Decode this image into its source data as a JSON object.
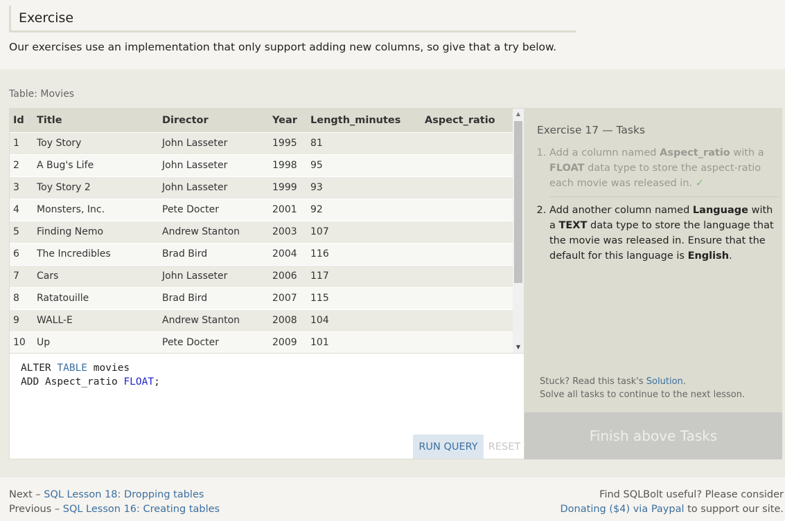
{
  "section": {
    "title": "Exercise",
    "intro": "Our exercises use an implementation that only support adding new columns, so give that a try below."
  },
  "table": {
    "caption": "Table: Movies",
    "columns": [
      "Id",
      "Title",
      "Director",
      "Year",
      "Length_minutes",
      "Aspect_ratio"
    ],
    "rows": [
      [
        "1",
        "Toy Story",
        "John Lasseter",
        "1995",
        "81",
        ""
      ],
      [
        "2",
        "A Bug's Life",
        "John Lasseter",
        "1998",
        "95",
        ""
      ],
      [
        "3",
        "Toy Story 2",
        "John Lasseter",
        "1999",
        "93",
        ""
      ],
      [
        "4",
        "Monsters, Inc.",
        "Pete Docter",
        "2001",
        "92",
        ""
      ],
      [
        "5",
        "Finding Nemo",
        "Andrew Stanton",
        "2003",
        "107",
        ""
      ],
      [
        "6",
        "The Incredibles",
        "Brad Bird",
        "2004",
        "116",
        ""
      ],
      [
        "7",
        "Cars",
        "John Lasseter",
        "2006",
        "117",
        ""
      ],
      [
        "8",
        "Ratatouille",
        "Brad Bird",
        "2007",
        "115",
        ""
      ],
      [
        "9",
        "WALL-E",
        "Andrew Stanton",
        "2008",
        "104",
        ""
      ],
      [
        "10",
        "Up",
        "Pete Docter",
        "2009",
        "101",
        ""
      ]
    ]
  },
  "editor": {
    "line1_kw1": "ALTER",
    "line1_kw2": "TABLE",
    "line1_ident": "movies",
    "line2_kw": "ADD",
    "line2_ident": "Aspect_ratio",
    "line2_type": "FLOAT",
    "line2_end": ";",
    "run_label": "RUN QUERY",
    "reset_label": "RESET"
  },
  "tasks": {
    "title": "Exercise 17 — Tasks",
    "task1": {
      "t1": "Add a column named ",
      "b1": "Aspect_ratio",
      "t2": " with a ",
      "b2": "FLOAT",
      "t3": " data type to store the aspect-ratio each movie was released in. ",
      "check": "✓"
    },
    "task2": {
      "t1": "Add another column named ",
      "b1": "Language",
      "t2": " with a ",
      "b2": "TEXT",
      "t3": " data type to store the language that the movie was released in. Ensure that the default for this language is ",
      "b3": "English",
      "t4": "."
    },
    "stuck_prefix": "Stuck? Read this task's ",
    "solution_link": "Solution",
    "stuck_suffix": ".",
    "solve_note": "Solve all tasks to continue to the next lesson.",
    "finish_label": "Finish above Tasks"
  },
  "footer": {
    "next_prefix": "Next – ",
    "next_link": "SQL Lesson 18: Dropping tables",
    "prev_prefix": "Previous – ",
    "prev_link": "SQL Lesson 16: Creating tables",
    "support_line1": "Find SQLBolt useful? Please consider",
    "donate_link": "Donating ($4) via Paypal",
    "support_line2_suffix": " to support our site."
  },
  "colors": {
    "accent_link": "#3a6fa0",
    "table_header": "#dcdcd0",
    "tasks_panel": "#dcdcd0",
    "finish_button": "#c9c9c6"
  }
}
